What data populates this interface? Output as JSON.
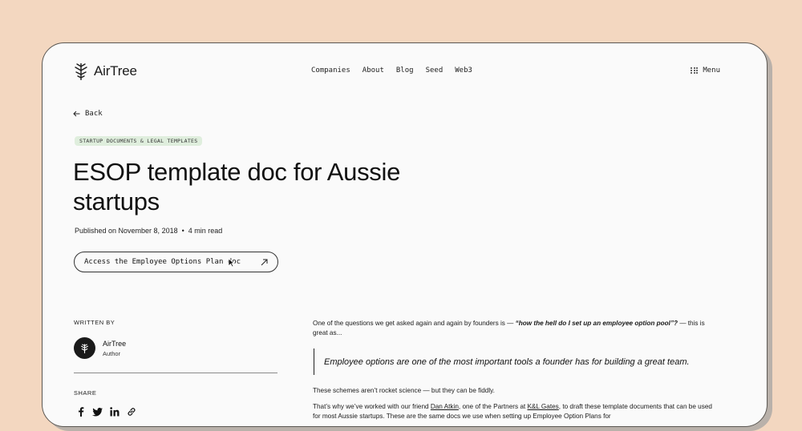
{
  "header": {
    "logo_text": "AirTree",
    "nav": [
      "Companies",
      "About",
      "Blog",
      "Seed",
      "Web3"
    ],
    "menu_label": "Menu"
  },
  "back_label": "Back",
  "badge": "STARTUP DOCUMENTS & LEGAL TEMPLATES",
  "title": "ESOP template doc for Aussie startups",
  "meta": {
    "published": "Published on November 8, 2018",
    "separator": "•",
    "read_time": "4 min read"
  },
  "cta_label": "Access the Employee Options Plan doc",
  "sidebar": {
    "written_by": "WRITTEN BY",
    "author_name": "AirTree",
    "author_role": "Author",
    "share": "SHARE"
  },
  "article": {
    "p1_start": "One of the questions we get asked again and again by founders is — ",
    "p1_quote": "“how the hell do I set up an employee option pool”?",
    "p1_end": " — this is great as...",
    "quote": "Employee options are one of the most important tools a founder has for building a great team.",
    "p2": "These schemes aren’t rocket science — but they can be fiddly.",
    "p3_a": "That’s why we’ve worked with our friend ",
    "p3_link1": "Dan Atkin",
    "p3_b": ", one of the Partners at ",
    "p3_link2": "K&L Gates",
    "p3_c": ", to draft these template documents that can be used for most Aussie startups. These are the same docs we use when setting up Employee Option Plans for"
  }
}
